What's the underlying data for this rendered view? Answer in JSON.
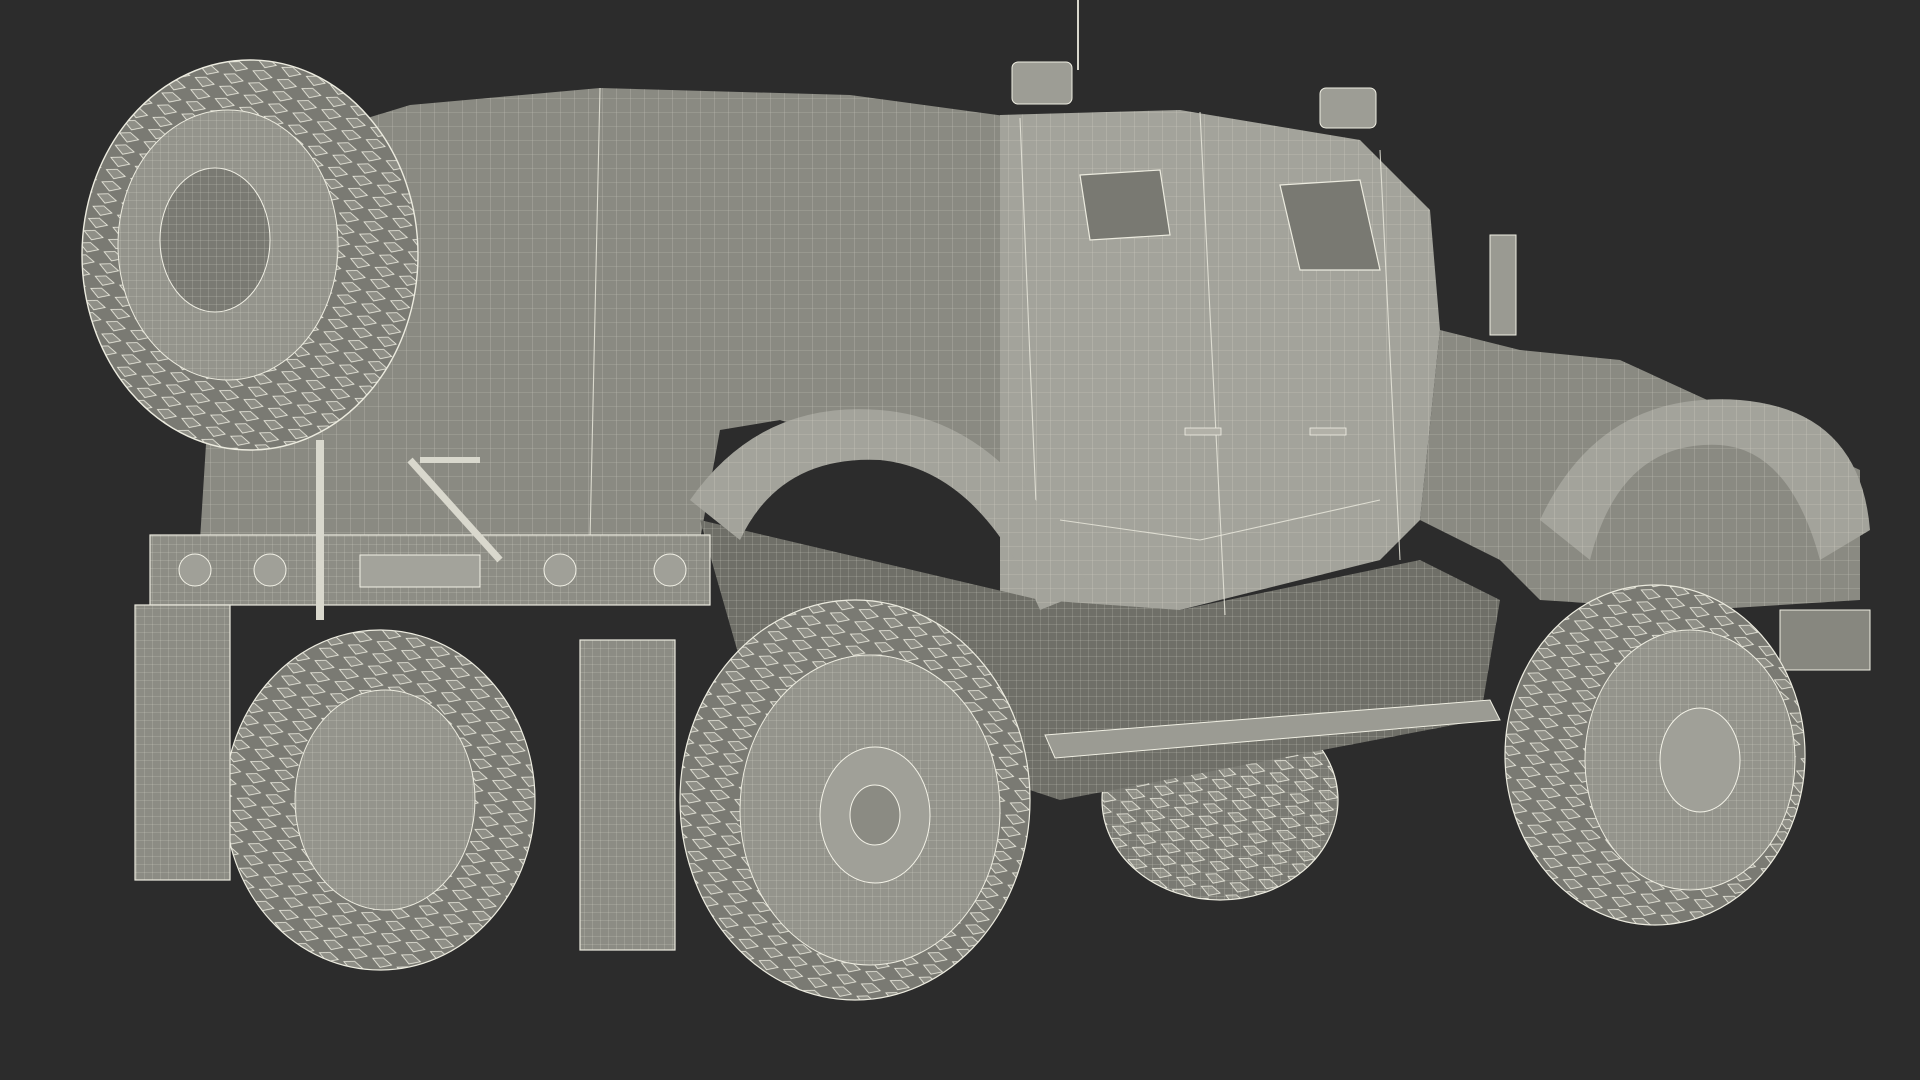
{
  "scene": {
    "subject_icon": "wireframe-armored-vehicle",
    "colors": {
      "background": "#2c2c2c",
      "model_fill": "#8a8a82",
      "wireframe": "#e9e8dc"
    }
  }
}
